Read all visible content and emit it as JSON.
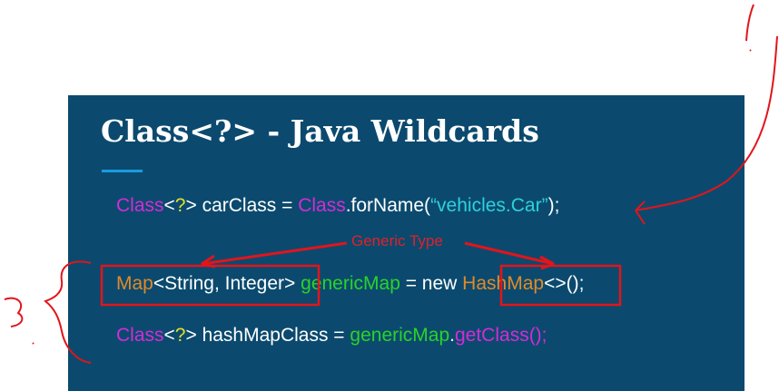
{
  "slide": {
    "title": "Class<?> - Java Wildcards",
    "lines": [
      [
        {
          "t": "Class",
          "c": "m"
        },
        {
          "t": "<",
          "c": "w"
        },
        {
          "t": "?",
          "c": "y"
        },
        {
          "t": "> carClass = ",
          "c": "w"
        },
        {
          "t": "Class",
          "c": "m"
        },
        {
          "t": ".forName(",
          "c": "w"
        },
        {
          "t": "“vehicles.Car”",
          "c": "c"
        },
        {
          "t": ");",
          "c": "w"
        }
      ],
      [
        {
          "t": "Map",
          "c": "o"
        },
        {
          "t": "<String, Integer> ",
          "c": "w"
        },
        {
          "t": "genericMap",
          "c": "g"
        },
        {
          "t": " = new ",
          "c": "w"
        },
        {
          "t": "HashMap",
          "c": "o"
        },
        {
          "t": "<>();",
          "c": "w"
        }
      ],
      [
        {
          "t": "Class",
          "c": "m"
        },
        {
          "t": "<",
          "c": "w"
        },
        {
          "t": "?",
          "c": "y"
        },
        {
          "t": "> hashMapClass = ",
          "c": "w"
        },
        {
          "t": "genericMap",
          "c": "g"
        },
        {
          "t": ".",
          "c": "w"
        },
        {
          "t": "getClass();",
          "c": "m"
        }
      ]
    ]
  },
  "annotation": {
    "label": "Generic Type"
  }
}
